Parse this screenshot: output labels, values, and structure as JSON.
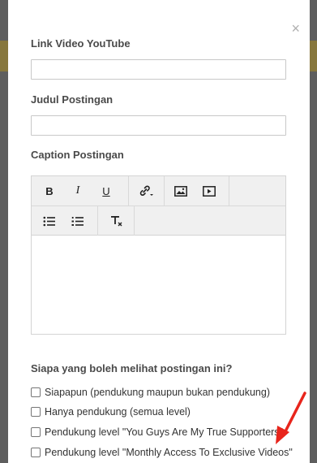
{
  "modal": {
    "close_glyph": "×",
    "youtube_label": "Link Video YouTube",
    "youtube_value": "",
    "title_label": "Judul Postingan",
    "title_value": "",
    "caption_label": "Caption Postingan",
    "editor_toolbar": {
      "bold": "B",
      "italic": "I",
      "underline": "U",
      "link_icon": "link-icon",
      "image_icon": "image-icon",
      "video_icon": "video-icon",
      "bullet_list_icon": "bullet-list-icon",
      "numbered_list_icon": "numbered-list-icon",
      "clear_format_icon": "clear-format-icon"
    },
    "visibility_question": "Siapa yang boleh melihat postingan ini?",
    "visibility_options": [
      {
        "label": "Siapapun (pendukung maupun bukan pendukung)",
        "checked": false
      },
      {
        "label": "Hanya pendukung (semua level)",
        "checked": false
      },
      {
        "label": "Pendukung level \"You Guys Are My True Supporters\"",
        "checked": false
      },
      {
        "label": "Pendukung level \"Monthly Access To Exclusive Videos\"",
        "checked": false
      }
    ]
  },
  "annotation": {
    "arrow_color": "#e8251c"
  }
}
